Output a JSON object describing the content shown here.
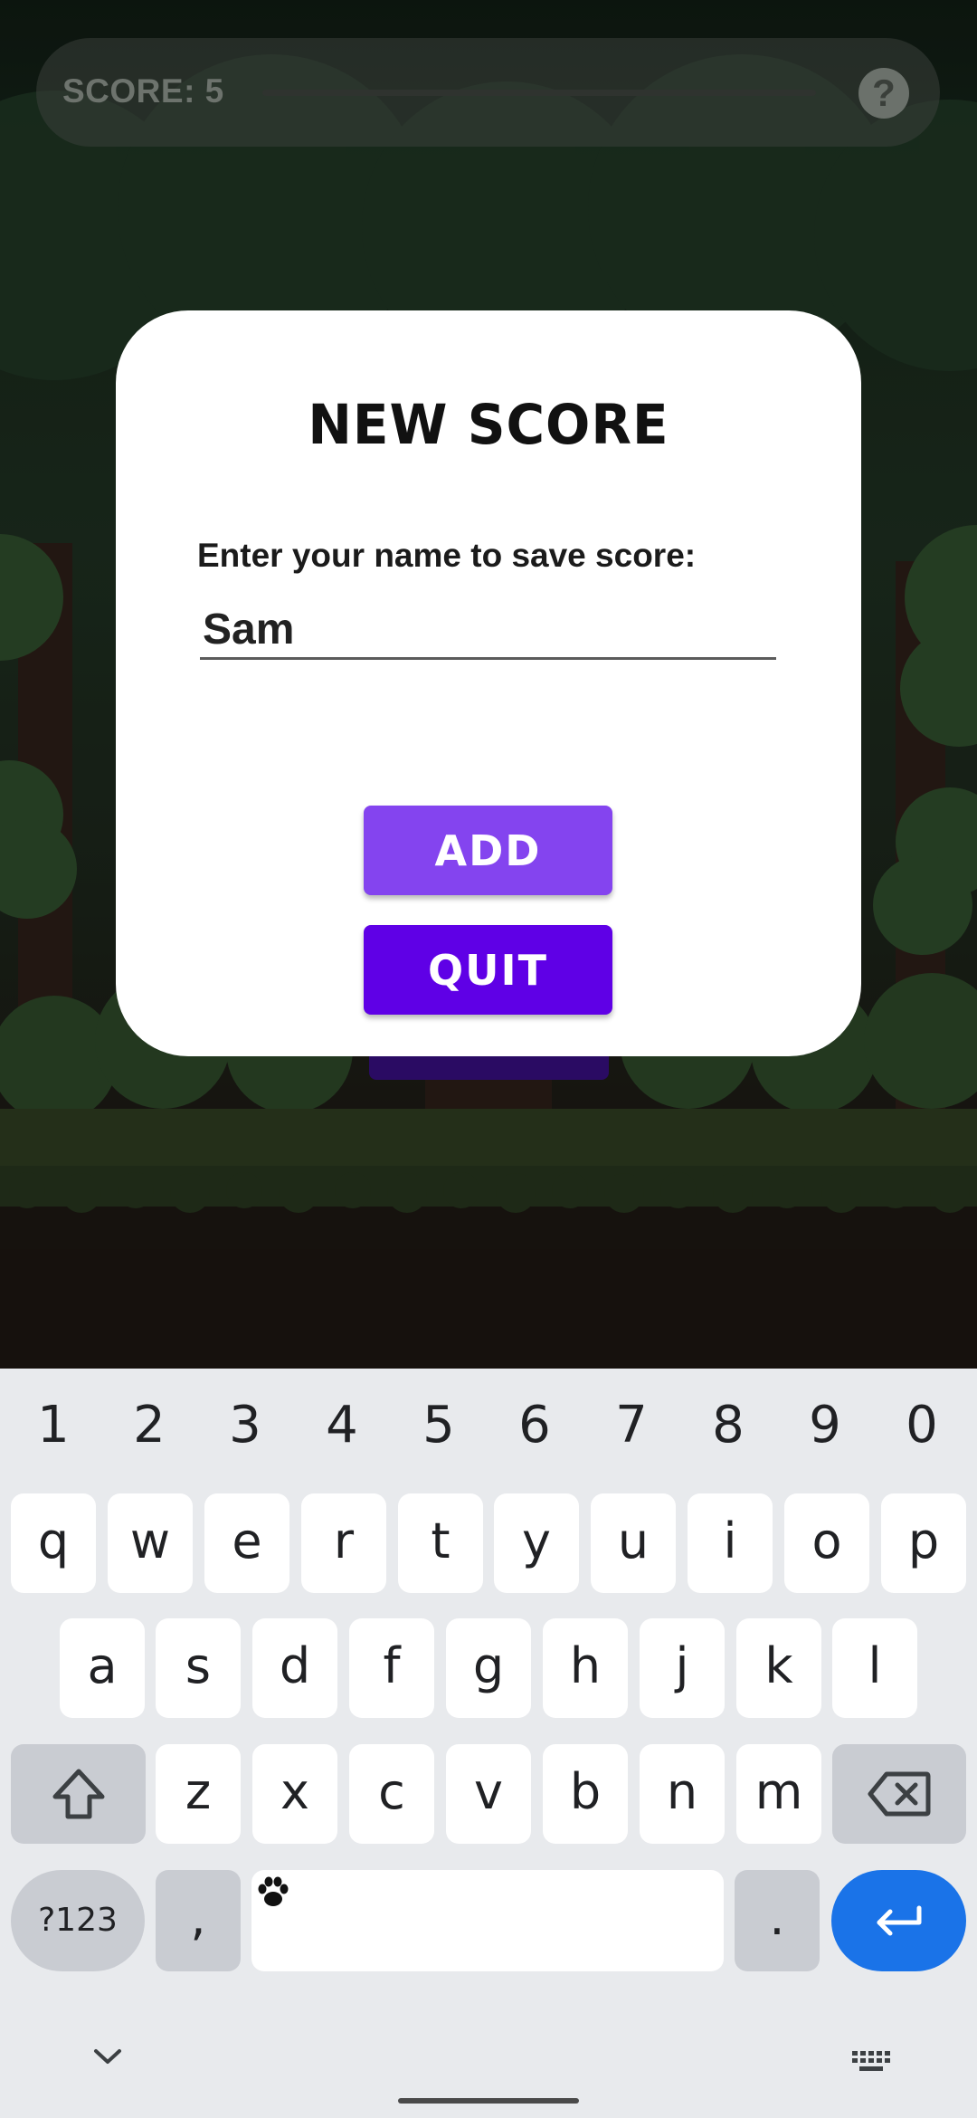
{
  "app": {
    "score_label": "SCORE: 5",
    "help_icon": "?"
  },
  "dialog": {
    "title": "NEW SCORE",
    "prompt": "Enter your name to save score:",
    "name_value": "Sam",
    "add_label": "ADD",
    "quit_label": "QUIT"
  },
  "keyboard": {
    "numbers": [
      "1",
      "2",
      "3",
      "4",
      "5",
      "6",
      "7",
      "8",
      "9",
      "0"
    ],
    "row1": [
      "q",
      "w",
      "e",
      "r",
      "t",
      "y",
      "u",
      "i",
      "o",
      "p"
    ],
    "row2": [
      "a",
      "s",
      "d",
      "f",
      "g",
      "h",
      "j",
      "k",
      "l"
    ],
    "row3": [
      "z",
      "x",
      "c",
      "v",
      "b",
      "n",
      "m"
    ],
    "symbols_label": "?123",
    "comma_label": ",",
    "period_label": "."
  },
  "colors": {
    "add_button": "#8444ef",
    "quit_button": "#5f00e6",
    "enter_key": "#1a73e8"
  },
  "icons": [
    "help-icon",
    "shift-icon",
    "backspace-icon",
    "enter-icon",
    "paw-icon",
    "hide-keyboard-icon",
    "keyboard-switch-icon"
  ]
}
